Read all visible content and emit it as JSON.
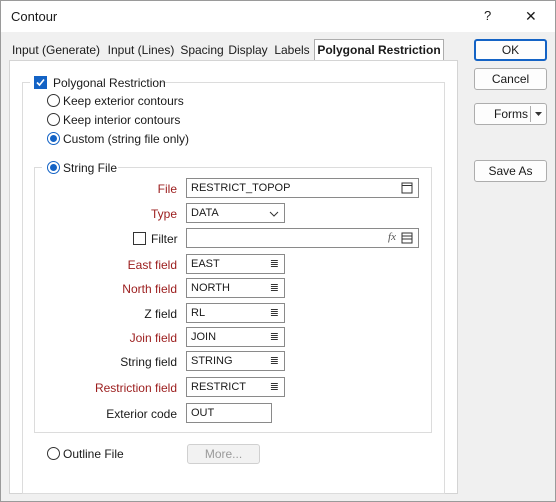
{
  "window": {
    "title": "Contour",
    "help": "?",
    "close": "✕"
  },
  "tabs": [
    "Input (Generate)",
    "Input (Lines)",
    "Spacing",
    "Display",
    "Labels",
    "Polygonal Restriction"
  ],
  "polygonal_restriction": {
    "label": "Polygonal Restriction",
    "checked": true,
    "options": [
      "Keep exterior contours",
      "Keep interior contours",
      "Custom (string file only)"
    ],
    "selected_option": "Custom (string file only)"
  },
  "string_file": {
    "label": "String File",
    "file_label": "File",
    "file_value": "RESTRICT_TOPOP",
    "type_label": "Type",
    "type_value": "DATA",
    "filter_label": "Filter",
    "filter_value": "",
    "filter_icon": "fx",
    "fields": [
      {
        "label": "East field",
        "value": "EAST",
        "required": true
      },
      {
        "label": "North field",
        "value": "NORTH",
        "required": true
      },
      {
        "label": "Z field",
        "value": "RL",
        "required": false
      },
      {
        "label": "Join field",
        "value": "JOIN",
        "required": true
      },
      {
        "label": "String field",
        "value": "STRING",
        "required": false
      },
      {
        "label": "Restriction field",
        "value": "RESTRICT",
        "required": true
      }
    ],
    "exterior_code_label": "Exterior code",
    "exterior_code_value": "OUT"
  },
  "outline_file": {
    "label": "Outline File",
    "more_label": "More..."
  },
  "buttons": {
    "ok": "OK",
    "cancel": "Cancel",
    "forms": "Forms",
    "save_as": "Save As"
  },
  "colors": {
    "accent": "#1463c5",
    "required_label": "#9b1c1c"
  }
}
